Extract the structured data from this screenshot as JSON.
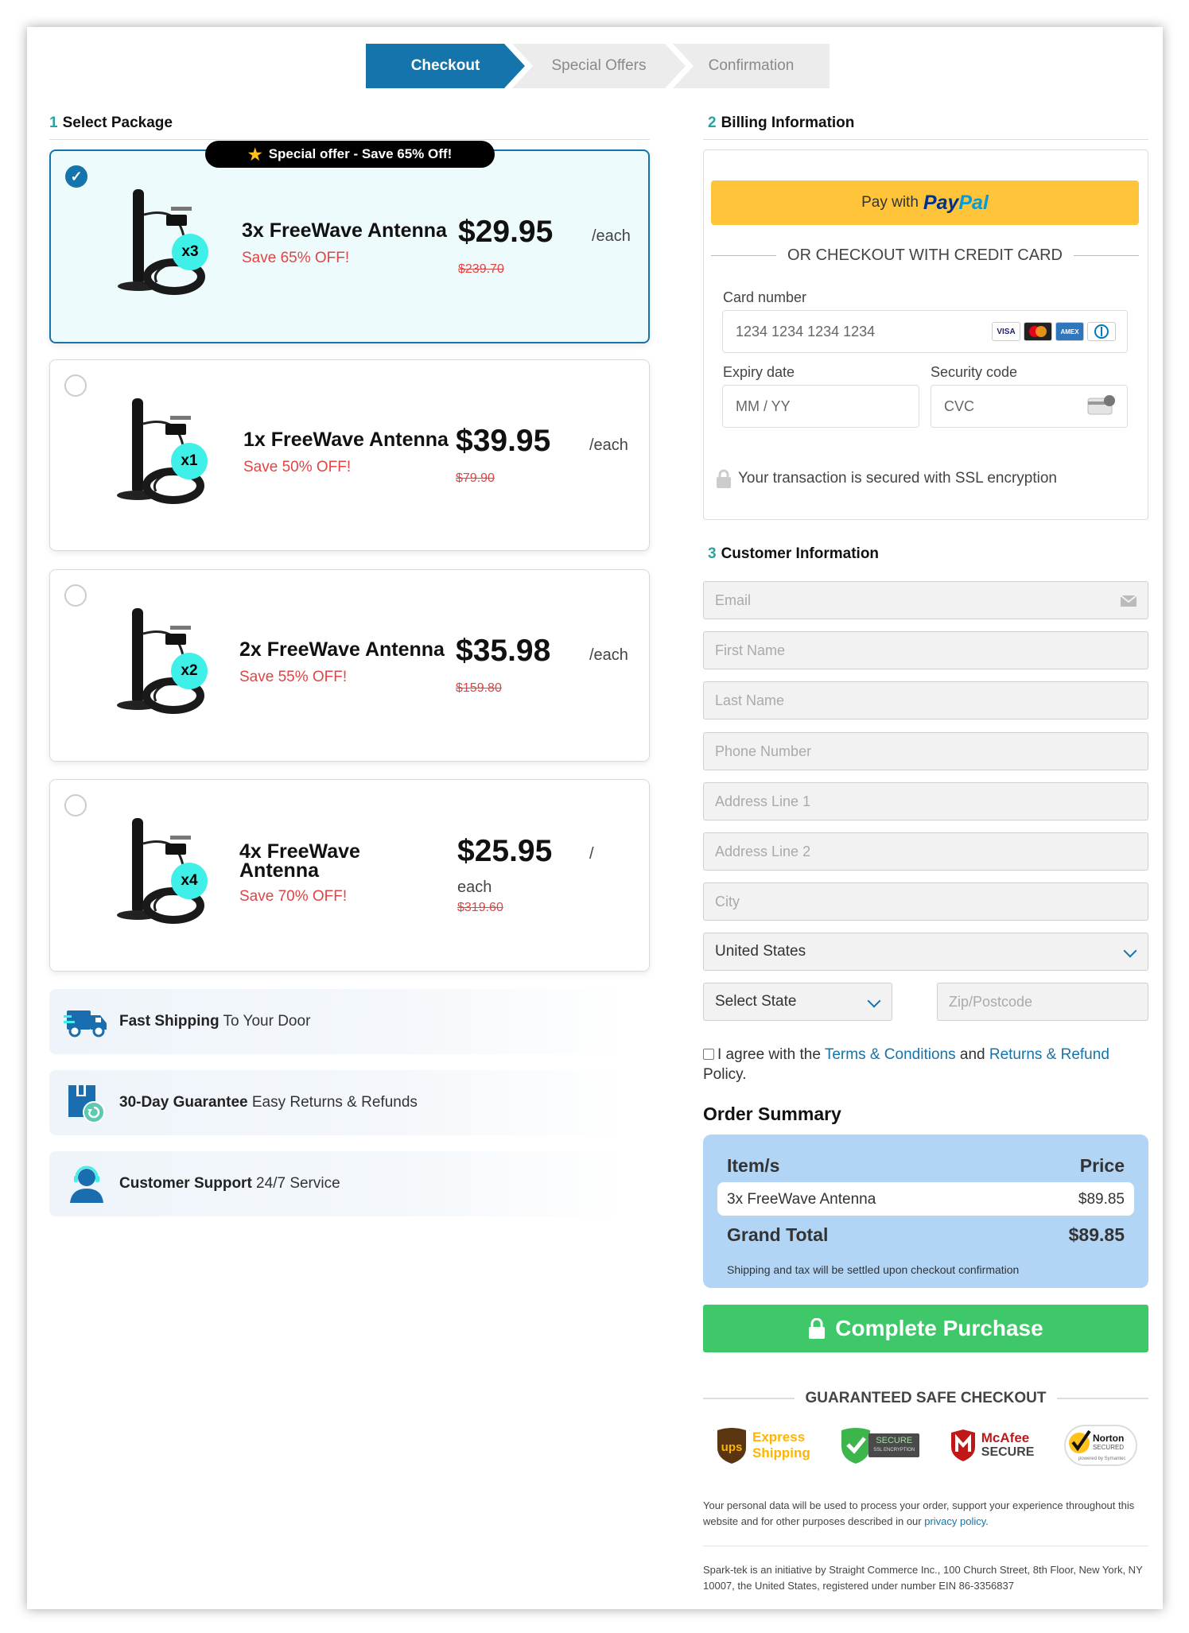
{
  "steps": {
    "checkout": "Checkout",
    "offers": "Special Offers",
    "confirm": "Confirmation"
  },
  "sections": {
    "package_num": "1",
    "package_title": "Select Package",
    "billing_num": "2",
    "billing_title": "Billing Information",
    "customer_num": "3",
    "customer_title": "Customer Information"
  },
  "offer_badge": "Special offer - Save 65% Off!",
  "packages": [
    {
      "name": "3x FreeWave Antenna",
      "save": "Save 65% OFF!",
      "price": "$29.95",
      "each": "/each",
      "old": "$239.70",
      "qty": "x3",
      "selected": true
    },
    {
      "name": "1x FreeWave Antenna",
      "save": "Save 50% OFF!",
      "price": "$39.95",
      "each": "/each",
      "old": "$79.90",
      "qty": "x1",
      "selected": false
    },
    {
      "name": "2x FreeWave Antenna",
      "save": "Save 55% OFF!",
      "price": "$35.98",
      "each": "/each",
      "old": "$159.80",
      "qty": "x2",
      "selected": false
    },
    {
      "name": "4x FreeWave Antenna",
      "save": "Save 70% OFF!",
      "price": "$25.95",
      "each_a": "/",
      "each_b": "each",
      "old": "$319.60",
      "qty": "x4",
      "selected": false
    }
  ],
  "features": [
    {
      "bold": "Fast Shipping",
      "rest": " To Your Door"
    },
    {
      "bold": "30-Day Guarantee",
      "rest": " Easy Returns & Refunds"
    },
    {
      "bold": "Customer Support",
      "rest": " 24/7 Service"
    }
  ],
  "billing": {
    "paypal_prefix": "Pay with",
    "paypal_a": "Pay",
    "paypal_b": "Pal",
    "or_text": "OR CHECKOUT WITH CREDIT CARD",
    "card_label": "Card number",
    "card_placeholder": "1234 1234 1234 1234",
    "expiry_label": "Expiry date",
    "expiry_placeholder": "MM / YY",
    "cvc_label": "Security code",
    "cvc_placeholder": "CVC",
    "ssl": "Your transaction is secured with SSL encryption",
    "card_brands": [
      "VISA",
      "MC",
      "AMEX",
      "DC"
    ]
  },
  "customer": {
    "email": "Email",
    "first": "First Name",
    "last": "Last Name",
    "phone": "Phone Number",
    "addr1": "Address Line 1",
    "addr2": "Address Line 2",
    "city": "City",
    "country": "United States",
    "state": "Select State",
    "zip": "Zip/Postcode"
  },
  "agree": {
    "a": "I agree with the ",
    "terms": "Terms & Conditions",
    "and": " and ",
    "returns": "Returns & Refund",
    "b": " Policy."
  },
  "summary": {
    "title": "Order Summary",
    "col_item": "Item/s",
    "col_price": "Price",
    "item": "3x FreeWave Antenna",
    "item_price": "$89.85",
    "total_label": "Grand Total",
    "total": "$89.85",
    "note": "Shipping and tax will be settled upon checkout confirmation"
  },
  "purchase_button": "Complete Purchase",
  "guaranteed": "GUARANTEED SAFE CHECKOUT",
  "trust": {
    "ups": "ups",
    "ups_a": "Express",
    "ups_b": "Shipping",
    "secure": "SECURE",
    "secure_sub": "SSL ENCRYPTION",
    "mcafee_a": "McAfee",
    "mcafee_b": "SECURE",
    "norton_a": "Norton",
    "norton_b": "SECURED",
    "norton_c": "powered by Symantec"
  },
  "legal": {
    "privacy_a": "Your personal data will be used to process your order, support your experience throughout this website and for other purposes described in our ",
    "privacy_link": "privacy policy",
    "privacy_b": ".",
    "company": "Spark-tek is an initiative by Straight Commerce Inc., 100 Church Street, 8th Floor, New York, NY 10007, the United States, registered under number EIN 86-3356837"
  },
  "colors": {
    "primary": "#1474ab",
    "accent": "#3ff0e8",
    "save": "#e04444",
    "buy": "#3ec86a",
    "paypal": "#ffc43a",
    "summary": "#b2d5f5"
  }
}
